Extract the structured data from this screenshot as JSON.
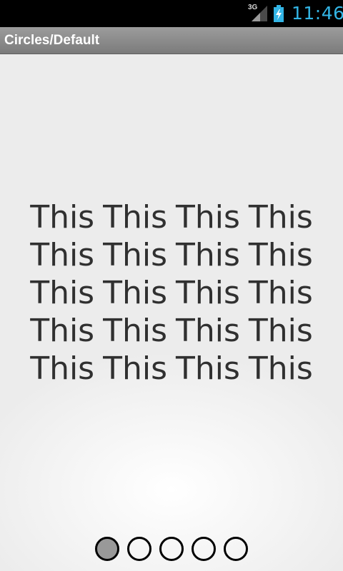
{
  "status_bar": {
    "network": "3G",
    "time": "11:46",
    "time_color": "#33b5e5",
    "icons": [
      "signal-icon",
      "battery-charging-icon"
    ]
  },
  "title_bar": {
    "title": "Circles/Default"
  },
  "page": {
    "lines": [
      "This This This This",
      "This This This This",
      "This This This This",
      "This This This This",
      "This This This This"
    ]
  },
  "indicator": {
    "page_count": 5,
    "current_page": 1,
    "active_fill": "#999999",
    "stroke": "#000000"
  }
}
